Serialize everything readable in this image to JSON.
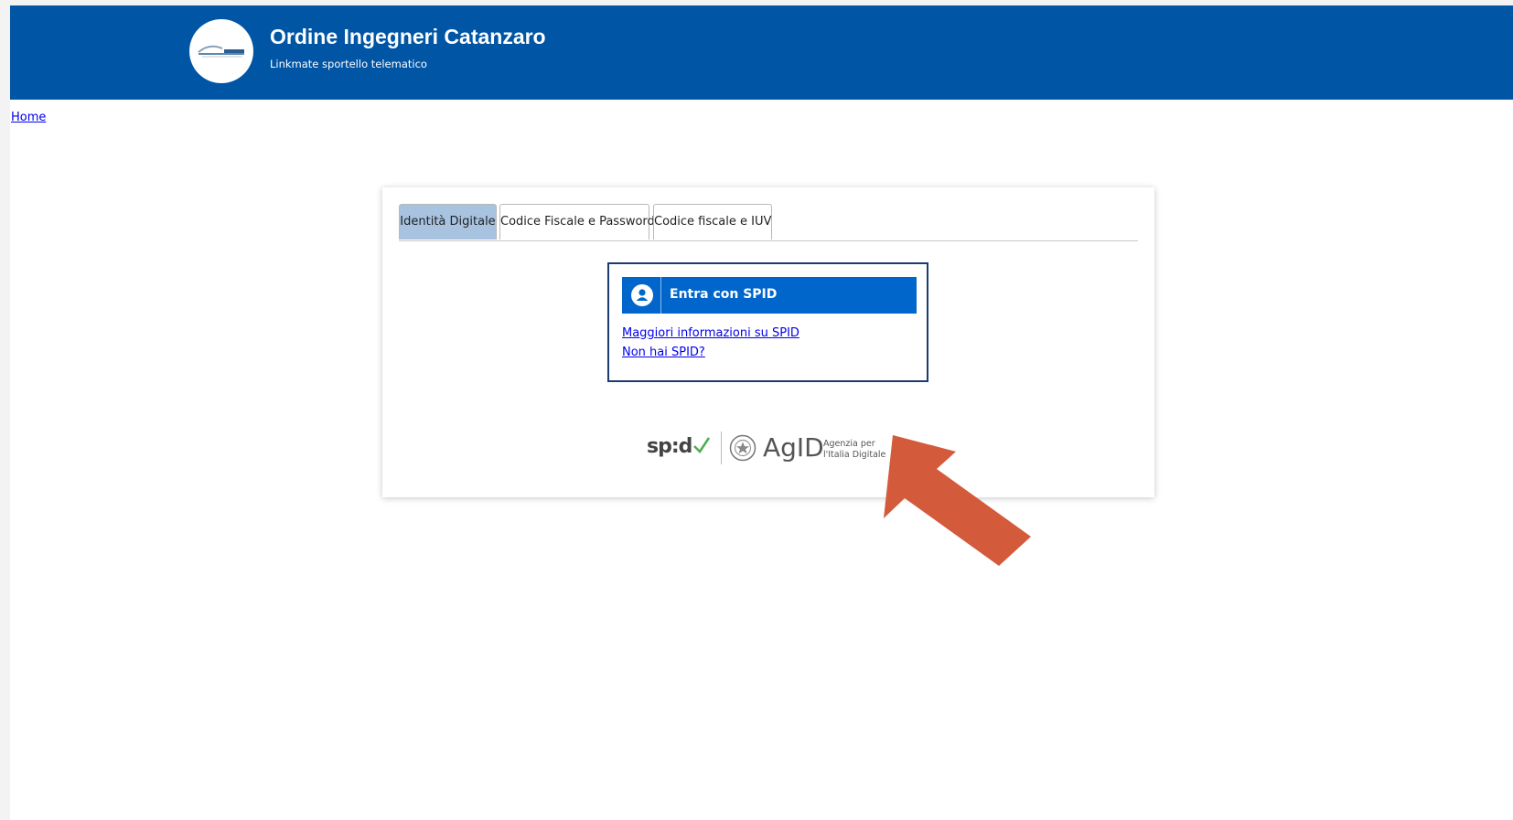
{
  "header": {
    "title": "Ordine Ingegneri Catanzaro",
    "subtitle": "Linkmate sportello telematico",
    "background_color": "#0055a5"
  },
  "breadcrumb": {
    "home": "Home"
  },
  "tabs": [
    {
      "label": "Identità Digitale",
      "active": true
    },
    {
      "label": "Codice Fiscale e Password",
      "active": false
    },
    {
      "label": "Codice fiscale e IUV",
      "active": false
    }
  ],
  "spid_panel": {
    "button_label": "Entra con SPID",
    "button_color": "#0066cc",
    "link_more_info": "Maggiori informazioni su SPID",
    "link_no_spid": "Non hai SPID?"
  },
  "logos": {
    "spid_text": "sp:d",
    "agid_text": "AgID",
    "agid_subtitle_line1": "Agenzia per",
    "agid_subtitle_line2": "l'Italia Digitale"
  },
  "annotation": {
    "arrow_color": "#d35a3a",
    "arrow_icon": "arrow-up-left-icon"
  }
}
